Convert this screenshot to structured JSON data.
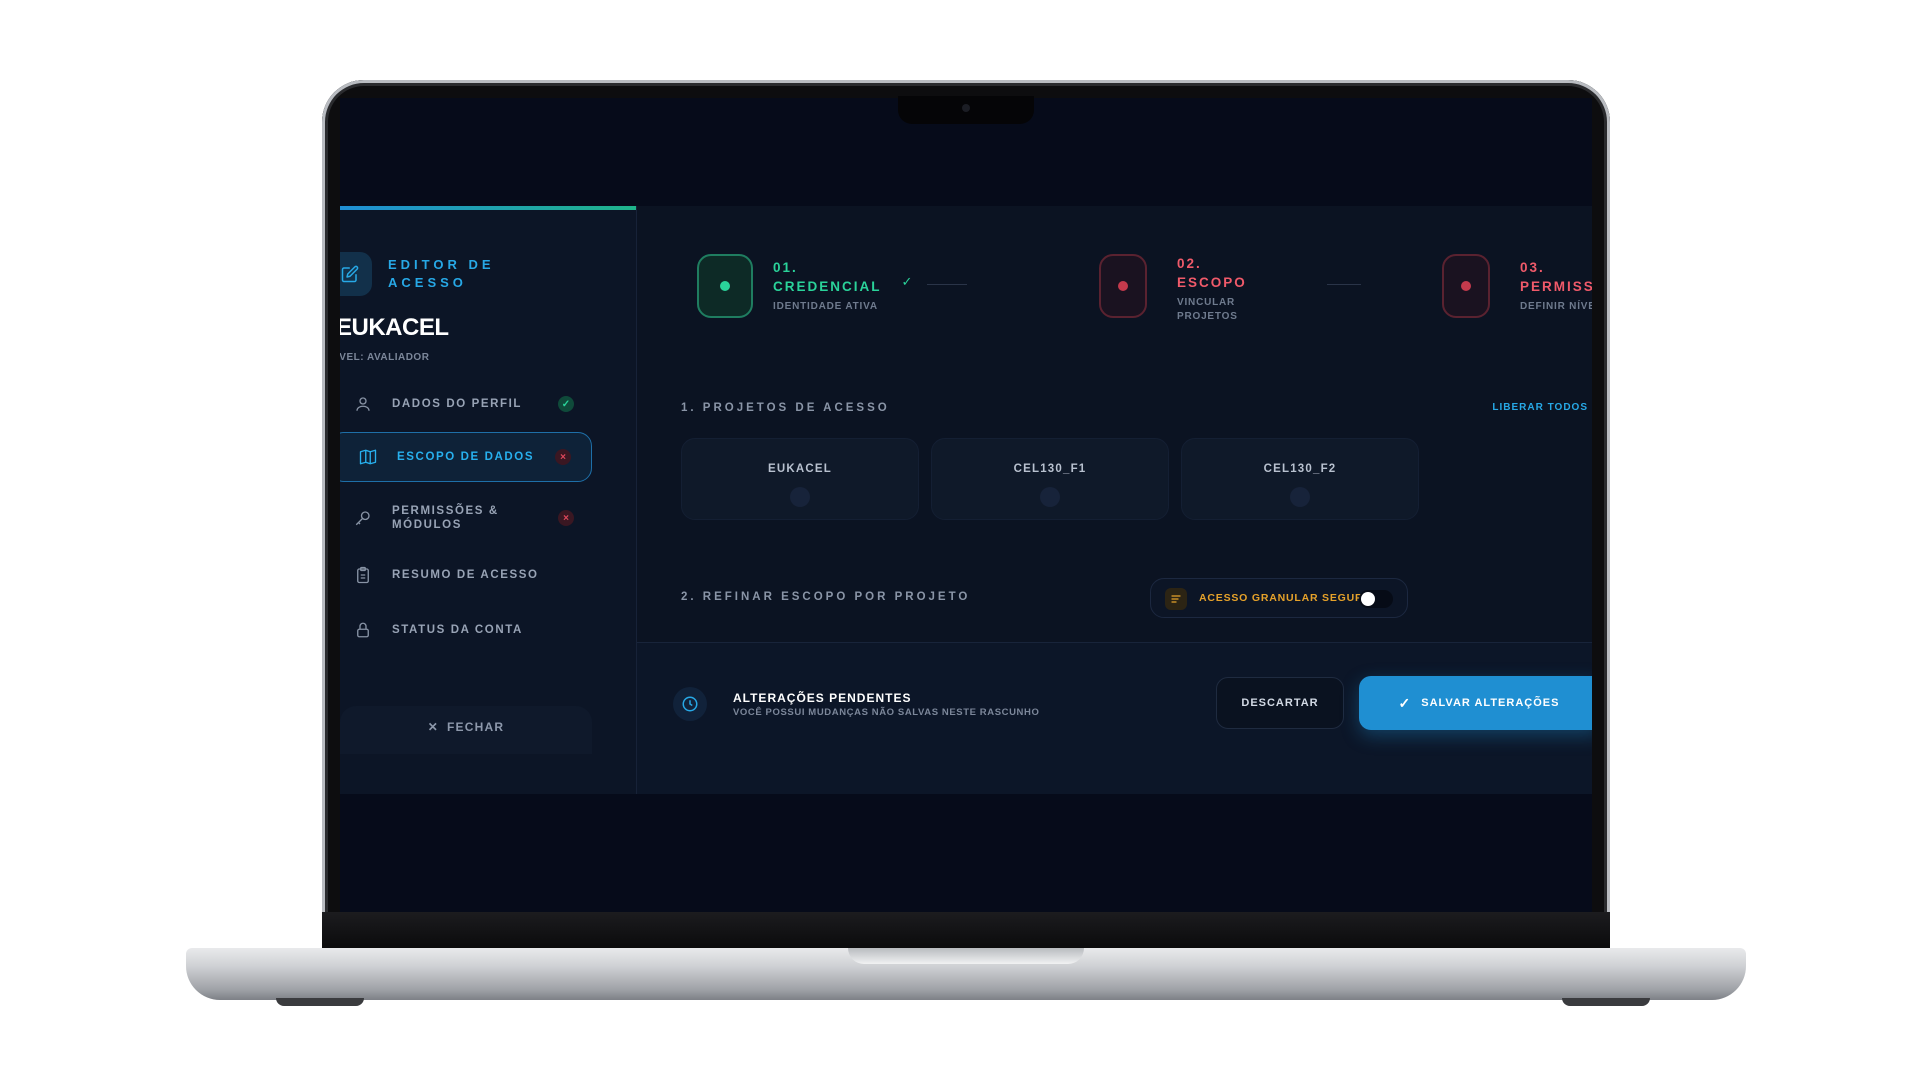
{
  "sidebar": {
    "title": "EDITOR DE ACESSO",
    "user_name": "EUKACEL",
    "user_level": "ÍVEL: AVALIADOR",
    "items": [
      {
        "label": "DADOS DO PERFIL",
        "icon": "user-icon",
        "status": "ok"
      },
      {
        "label": "ESCOPO DE DADOS",
        "icon": "map-icon",
        "status": "error",
        "active": true
      },
      {
        "label": "PERMISSÕES & MÓDULOS",
        "icon": "key-icon",
        "status": "error"
      },
      {
        "label": "RESUMO DE ACESSO",
        "icon": "clipboard-icon"
      },
      {
        "label": "STATUS DA CONTA",
        "icon": "lock-icon"
      }
    ],
    "close_label": "FECHAR"
  },
  "steps": [
    {
      "num": "01.",
      "name": "CREDENCIAL",
      "desc": "IDENTIDADE ATIVA",
      "state": "done",
      "color": "#2ad39a"
    },
    {
      "num": "02.",
      "name": "ESCOPO",
      "desc": "VINCULAR PROJETOS",
      "state": "error",
      "color": "#f05a6a"
    },
    {
      "num": "03.",
      "name": "PERMISSÕ",
      "desc": "DEFINIR NÍVE",
      "state": "error",
      "color": "#f05a6a"
    }
  ],
  "projects": {
    "section_title": "1. PROJETOS DE ACESSO",
    "action_label": "LIBERAR TODOS",
    "items": [
      "EUKACEL",
      "CEL130_F1",
      "CEL130_F2"
    ]
  },
  "refine": {
    "section_title": "2. REFINAR ESCOPO POR PROJETO",
    "toggle_label": "ACESSO GRANULAR SEGURO",
    "toggle_on": false
  },
  "pending": {
    "title": "ALTERAÇÕES PENDENTES",
    "subtitle": "VOCÊ POSSUI MUDANÇAS NÃO SALVAS NESTE RASCUNHO",
    "discard_label": "DESCARTAR",
    "save_label": "SALVAR ALTERAÇÕES"
  },
  "colors": {
    "accent": "#27a8e6",
    "success": "#2ad39a",
    "error": "#e0485c",
    "warning": "#e6a22a"
  }
}
